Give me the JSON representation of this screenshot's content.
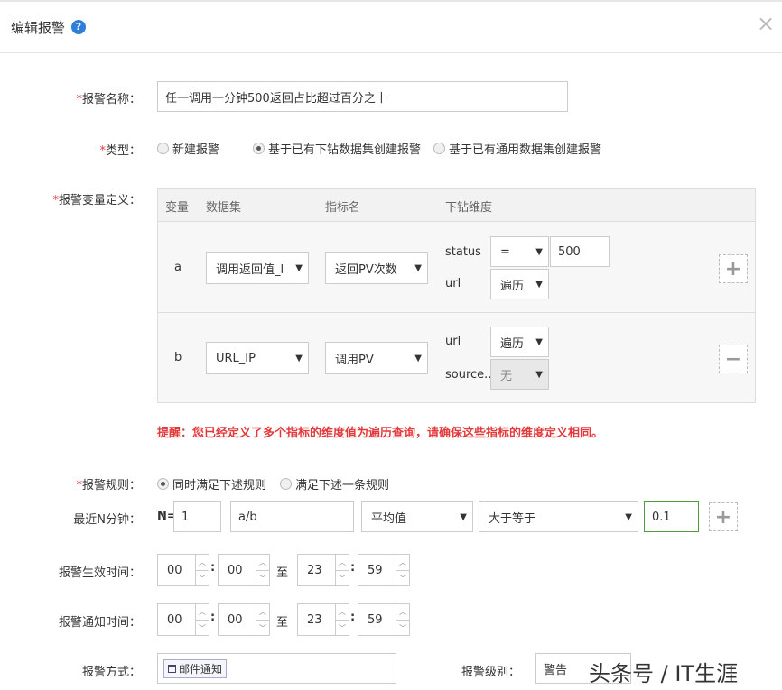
{
  "dialog": {
    "title": "编辑报警",
    "help_icon": "question-circle-icon",
    "close_icon": "close-icon",
    "close_glyph": "×",
    "help_glyph": "?"
  },
  "req_mark": "*",
  "name": {
    "label": "报警名称：",
    "value": "任一调用一分钟500返回占比超过百分之十"
  },
  "type": {
    "label": "类型：",
    "options": [
      "新建报警",
      "基于已有下钻数据集创建报警",
      "基于已有通用数据集创建报警"
    ],
    "selected": "基于已有下钻数据集创建报警"
  },
  "vars": {
    "label": "报警变量定义：",
    "headers": {
      "var": "变量",
      "dataset": "数据集",
      "metric": "指标名",
      "drill": "下钻维度"
    },
    "rows": [
      {
        "var": "a",
        "dataset": "调用返回值_l",
        "metric": "返回PV次数",
        "dims": [
          {
            "name": "status",
            "op": "=",
            "value": "500"
          },
          {
            "name": "url",
            "op": "遍历"
          }
        ],
        "action_glyph": "+"
      },
      {
        "var": "b",
        "dataset": "URL_IP",
        "metric": "调用PV",
        "dims": [
          {
            "name": "url",
            "op": "遍历"
          },
          {
            "name": "source...",
            "op": "无"
          }
        ],
        "action_glyph": "−"
      }
    ]
  },
  "warning": "提醒：您已经定义了多个指标的维度值为遍历查询，请确保这些指标的维度定义相同。",
  "rules": {
    "label": "报警规则：",
    "options": [
      "同时满足下述规则",
      "满足下述一条规则"
    ],
    "selected": "同时满足下述规则"
  },
  "recent": {
    "label": "最近N分钟：",
    "n_label": "N=",
    "n_value": "1",
    "expr": "a/b",
    "agg": "平均值",
    "cmp": "大于等于",
    "threshold": "0.1",
    "add_glyph": "+"
  },
  "effective_time": {
    "label": "报警生效时间：",
    "start_h": "00",
    "start_m": "00",
    "to": "至",
    "end_h": "23",
    "end_m": "59",
    "sep": ":"
  },
  "notify_time": {
    "label": "报警通知时间：",
    "start_h": "00",
    "start_m": "00",
    "to": "至",
    "end_h": "23",
    "end_m": "59",
    "sep": ":"
  },
  "method": {
    "label": "报警方式：",
    "tag": "邮件通知",
    "tag_icon": "calendar-icon"
  },
  "level": {
    "label": "报警级别：",
    "value": "警告"
  },
  "watermark": "头条号 / IT生涯",
  "colors": {
    "required": "#e4393c",
    "warning": "#e4393c",
    "accent": "#2f7ed8",
    "threshold_border": "#4a9d3a"
  },
  "caret": "▼",
  "spin_up": "︿",
  "spin_down": "﹀"
}
